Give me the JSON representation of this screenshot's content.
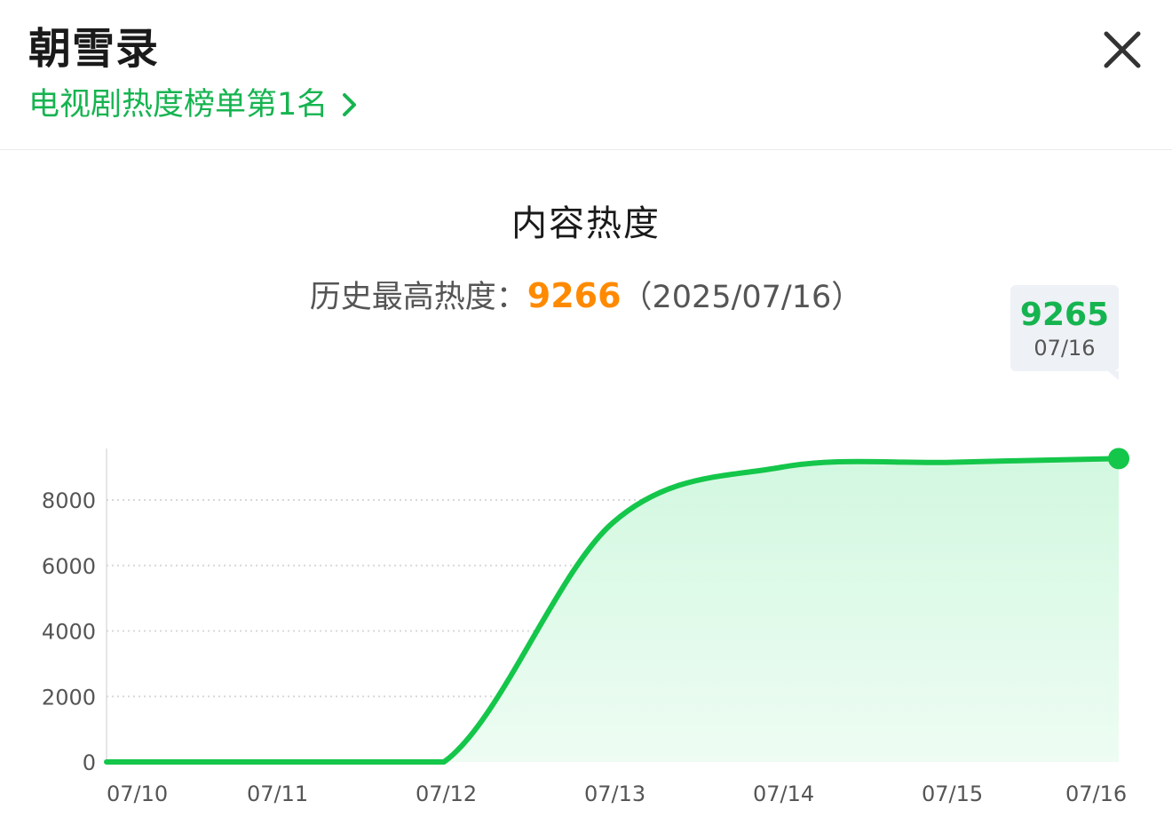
{
  "header": {
    "title": "朝雪录",
    "rank_label": "电视剧热度榜单第1名"
  },
  "chart_section": {
    "title": "内容热度",
    "peak_label": "历史最高热度：",
    "peak_value": "9266",
    "peak_date": "（2025/07/16）"
  },
  "tooltip": {
    "value": "9265",
    "date": "07/16"
  },
  "colors": {
    "accent_green": "#16b450",
    "peak_orange": "#ff8a00",
    "line_green": "#14c64a",
    "area_fill": "#d9f9e6"
  },
  "icons": {
    "chevron": "chevron-right-icon",
    "close": "close-icon"
  },
  "chart_data": {
    "type": "area",
    "title": "内容热度",
    "xlabel": "",
    "ylabel": "",
    "x": [
      "07/10",
      "07/11",
      "07/12",
      "07/13",
      "07/14",
      "07/15",
      "07/16"
    ],
    "values": [
      0,
      0,
      0,
      7300,
      9000,
      9150,
      9265
    ],
    "yticks": [
      0,
      2000,
      4000,
      6000,
      8000
    ],
    "ylim": [
      0,
      10000
    ],
    "grid": true,
    "highlight": {
      "x": "07/16",
      "value": 9265
    }
  }
}
